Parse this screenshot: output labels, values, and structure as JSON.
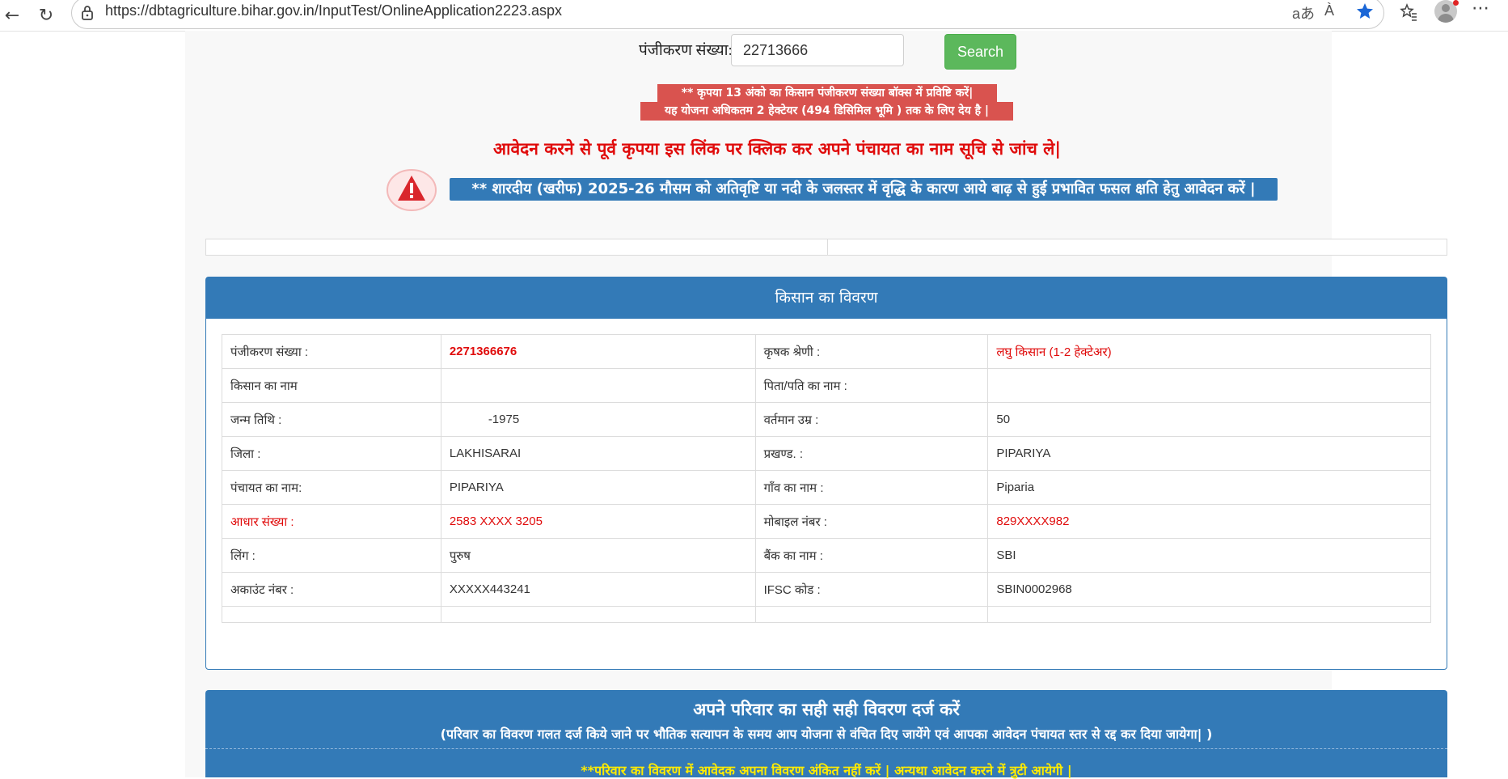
{
  "browser": {
    "url": "https://dbtagriculture.bihar.gov.in/InputTest/OnlineApplication2223.aspx",
    "read_aloud_icon_label": "aあ",
    "reader_icon_label": "À"
  },
  "search": {
    "label": "पंजीकरण संख्या:",
    "value": "22713666",
    "button_label": "Search"
  },
  "notices": {
    "line1": "** कृपया 13 अंको का किसान पंजीकरण संख्या बॉक्स में प्रविष्टि करें|",
    "line2": "यह योजना अधिकतम 2 हेक्टेयर (494 डिसिमिल भूमि ) तक के लिए देय है |",
    "panchayat_link": "आवेदन करने से पूर्व कृपया इस लिंक पर क्लिक कर अपने पंचायत का नाम सूचि से जांच ले|",
    "flood_banner": "** शारदीय (खरीफ) 2025-26 मौसम को अतिवृष्टि या नदी के जलस्तर में वृद्धि के कारण आये बाढ़ से हुई प्रभावित फसल क्षति हेतु आवेदन करें |"
  },
  "farmer": {
    "heading": "किसान का विवरण",
    "rows": [
      {
        "l1": "पंजीकरण संख्या :",
        "v1": "2271366676",
        "l2": "कृषक श्रेणी :",
        "v2": "लघु किसान (1-2 हेक्टेअर)"
      },
      {
        "l1": "किसान का नाम",
        "v1": "",
        "l2": "पिता/पति का नाम :",
        "v2": ""
      },
      {
        "l1": "जन्म तिथि :",
        "v1": "-1975",
        "l2": "वर्तमान उम्र :",
        "v2": "50"
      },
      {
        "l1": "जिला :",
        "v1": "LAKHISARAI",
        "l2": "प्रखण्ड. :",
        "v2": "PIPARIYA"
      },
      {
        "l1": "पंचायत का नाम:",
        "v1": "PIPARIYA",
        "l2": "गाँव का नाम :",
        "v2": "Piparia"
      },
      {
        "l1": "आधार संख्या :",
        "v1": "2583 XXXX 3205",
        "l2": "मोबाइल नंबर :",
        "v2": "829XXXX982"
      },
      {
        "l1": "लिंग :",
        "v1": "पुरुष",
        "l2": "बैंक का नाम :",
        "v2": "SBI"
      },
      {
        "l1": "अकाउंट नंबर :",
        "v1": "XXXXX443241",
        "l2": "IFSC कोड :",
        "v2": "SBIN0002968"
      }
    ]
  },
  "family": {
    "title": "अपने परिवार का सही सही विवरण दर्ज करें",
    "subtitle": "(परिवार का विवरण गलत दर्ज किये जाने पर भौतिक सत्यापन के समय आप योजना से वंचित दिए जायेंगे एवं आपका आवेदन पंचायत स्तर से रद्द कर दिया जायेगा| )",
    "warning": "**परिवार का विवरण में आवेदक अपना विवरण अंकित नहीं करें | अन्यथा आवेदन करने में त्रुटी आयेगी |"
  },
  "colors": {
    "primary_blue": "#337ab7",
    "success_green": "#5cb85c",
    "danger_red": "#d9534f",
    "alert_red": "#e00b0b",
    "warning_yellow": "#ffeb00"
  }
}
